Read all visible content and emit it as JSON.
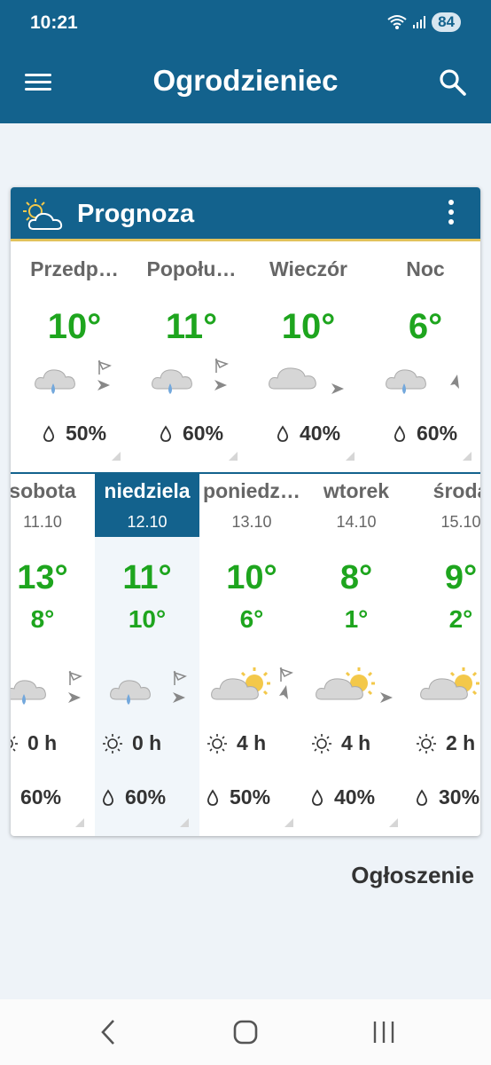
{
  "status": {
    "time": "10:21",
    "battery": "84"
  },
  "app_bar": {
    "title": "Ogrodzieniec",
    "menu_icon": "hamburger-menu-icon",
    "search_icon": "search-icon"
  },
  "forecast": {
    "header": "Prognoza",
    "day_parts": [
      {
        "name": "Przedp…",
        "temp": "10°",
        "precip": "50%",
        "icon": "cloud-rain-icon",
        "wind_icon": "windsock-icon"
      },
      {
        "name": "Popołu…",
        "temp": "11°",
        "precip": "60%",
        "icon": "cloud-rain-icon",
        "wind_icon": "windsock-icon"
      },
      {
        "name": "Wieczór",
        "temp": "10°",
        "precip": "40%",
        "icon": "cloud-icon",
        "wind_icon": ""
      },
      {
        "name": "Noc",
        "temp": "6°",
        "precip": "60%",
        "icon": "cloud-rain-icon",
        "wind_icon": ""
      }
    ],
    "days": [
      {
        "name": "sobota",
        "date": "11.10",
        "max": "13°",
        "min": "8°",
        "sun": "0 h",
        "precip": "60%",
        "icon": "cloud-rain-icon",
        "selected": false
      },
      {
        "name": "niedziela",
        "date": "12.10",
        "max": "11°",
        "min": "10°",
        "sun": "0 h",
        "precip": "60%",
        "icon": "cloud-rain-icon",
        "selected": true
      },
      {
        "name": "poniedz…",
        "date": "13.10",
        "max": "10°",
        "min": "6°",
        "sun": "4 h",
        "precip": "50%",
        "icon": "sun-cloud-icon",
        "selected": false
      },
      {
        "name": "wtorek",
        "date": "14.10",
        "max": "8°",
        "min": "1°",
        "sun": "4 h",
        "precip": "40%",
        "icon": "sun-cloud-icon",
        "selected": false
      },
      {
        "name": "środa",
        "date": "15.10",
        "max": "9°",
        "min": "2°",
        "sun": "2 h",
        "precip": "30%",
        "icon": "sun-cloud-icon",
        "selected": false
      }
    ]
  },
  "ad": {
    "label": "Ogłoszenie"
  },
  "colors": {
    "brand": "#13628d",
    "temperature": "#1ea51e",
    "accent": "#e2c25b"
  }
}
